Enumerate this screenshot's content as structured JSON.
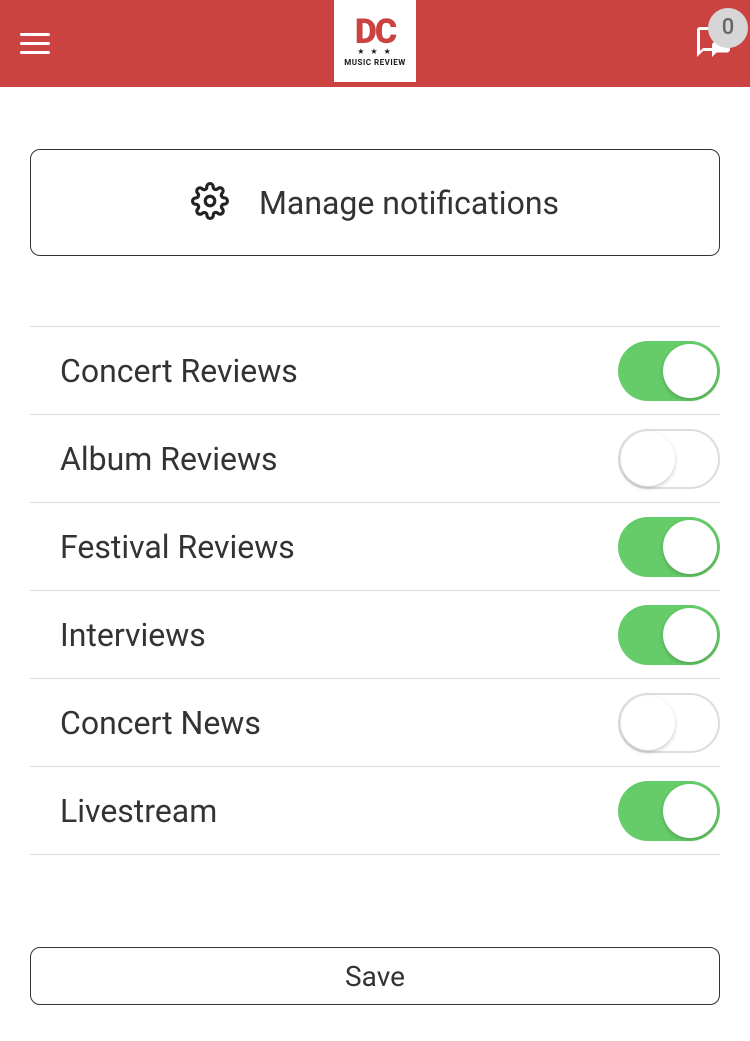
{
  "header": {
    "logo_main": "DC",
    "logo_sub": "MUSIC REVIEW",
    "badge_count": "0"
  },
  "manage": {
    "label": "Manage notifications"
  },
  "toggles": [
    {
      "label": "Concert Reviews",
      "on": true
    },
    {
      "label": "Album Reviews",
      "on": false
    },
    {
      "label": "Festival Reviews",
      "on": true
    },
    {
      "label": "Interviews",
      "on": true
    },
    {
      "label": "Concert News",
      "on": false
    },
    {
      "label": "Livestream",
      "on": true
    }
  ],
  "save": {
    "label": "Save"
  }
}
